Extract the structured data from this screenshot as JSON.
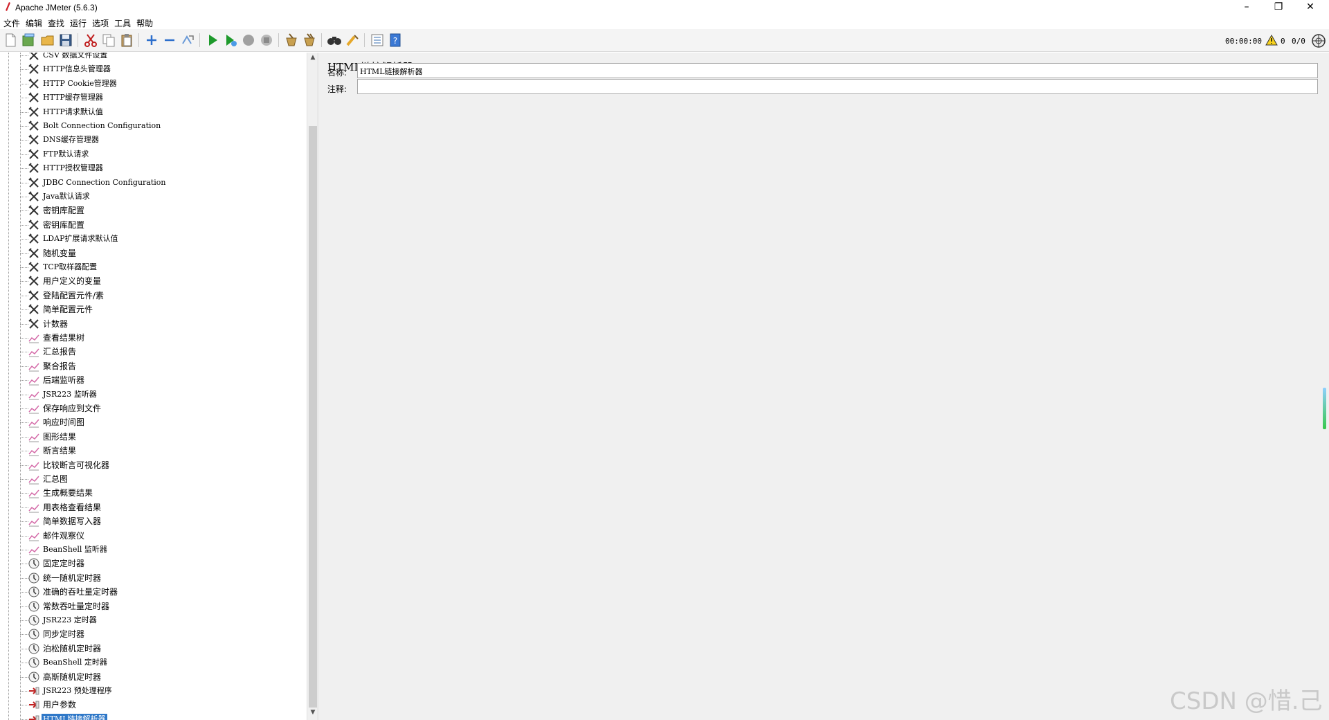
{
  "window": {
    "title": "Apache JMeter (5.6.3)",
    "minimize": "–",
    "restore": "❐",
    "close": "✕"
  },
  "menu": [
    "文件",
    "编辑",
    "查找",
    "运行",
    "选项",
    "工具",
    "帮助"
  ],
  "toolbar": {
    "buttons": [
      "new-icon",
      "templates-icon",
      "open-icon",
      "save-icon",
      "cut-icon",
      "copy-icon",
      "paste-icon",
      "expand-icon",
      "collapse-icon",
      "toggle-icon",
      "start-icon",
      "start-no-pause-icon",
      "stop-icon",
      "shutdown-icon",
      "clear-icon",
      "clear-all-icon",
      "search-icon",
      "reset-search-icon",
      "function-helper-icon",
      "help-icon"
    ]
  },
  "status": {
    "elapsed": "00:00:00",
    "warnings": "0",
    "threads": "0/0"
  },
  "tree": {
    "items": [
      {
        "label": "CSV 数据文件设置",
        "kind": "config"
      },
      {
        "label": "HTTP信息头管理器",
        "kind": "config"
      },
      {
        "label": "HTTP Cookie管理器",
        "kind": "config"
      },
      {
        "label": "HTTP缓存管理器",
        "kind": "config"
      },
      {
        "label": "HTTP请求默认值",
        "kind": "config"
      },
      {
        "label": "Bolt Connection Configuration",
        "kind": "config"
      },
      {
        "label": "DNS缓存管理器",
        "kind": "config"
      },
      {
        "label": "FTP默认请求",
        "kind": "config"
      },
      {
        "label": "HTTP授权管理器",
        "kind": "config"
      },
      {
        "label": "JDBC Connection Configuration",
        "kind": "config"
      },
      {
        "label": "Java默认请求",
        "kind": "config"
      },
      {
        "label": "密钥库配置",
        "kind": "config"
      },
      {
        "label": "密钥库配置",
        "kind": "config"
      },
      {
        "label": "LDAP扩展请求默认值",
        "kind": "config"
      },
      {
        "label": "随机变量",
        "kind": "config"
      },
      {
        "label": "TCP取样器配置",
        "kind": "config"
      },
      {
        "label": "用户定义的变量",
        "kind": "config"
      },
      {
        "label": "登陆配置元件/素",
        "kind": "config"
      },
      {
        "label": "简单配置元件",
        "kind": "config"
      },
      {
        "label": "计数器",
        "kind": "config"
      },
      {
        "label": "查看结果树",
        "kind": "listener"
      },
      {
        "label": "汇总报告",
        "kind": "listener"
      },
      {
        "label": "聚合报告",
        "kind": "listener"
      },
      {
        "label": "后端监听器",
        "kind": "listener"
      },
      {
        "label": "JSR223 监听器",
        "kind": "listener"
      },
      {
        "label": "保存响应到文件",
        "kind": "listener"
      },
      {
        "label": "响应时间图",
        "kind": "listener"
      },
      {
        "label": "图形结果",
        "kind": "listener"
      },
      {
        "label": "断言结果",
        "kind": "listener"
      },
      {
        "label": "比较断言可视化器",
        "kind": "listener"
      },
      {
        "label": "汇总图",
        "kind": "listener"
      },
      {
        "label": "生成概要结果",
        "kind": "listener"
      },
      {
        "label": "用表格查看结果",
        "kind": "listener"
      },
      {
        "label": "简单数据写入器",
        "kind": "listener"
      },
      {
        "label": "邮件观察仪",
        "kind": "listener"
      },
      {
        "label": "BeanShell 监听器",
        "kind": "listener"
      },
      {
        "label": "固定定时器",
        "kind": "timer"
      },
      {
        "label": "统一随机定时器",
        "kind": "timer"
      },
      {
        "label": "准确的吞吐量定时器",
        "kind": "timer"
      },
      {
        "label": "常数吞吐量定时器",
        "kind": "timer"
      },
      {
        "label": "JSR223 定时器",
        "kind": "timer"
      },
      {
        "label": "同步定时器",
        "kind": "timer"
      },
      {
        "label": "泊松随机定时器",
        "kind": "timer"
      },
      {
        "label": "BeanShell 定时器",
        "kind": "timer"
      },
      {
        "label": "高斯随机定时器",
        "kind": "timer"
      },
      {
        "label": "JSR223 预处理程序",
        "kind": "preprocessor"
      },
      {
        "label": "用户参数",
        "kind": "preprocessor"
      },
      {
        "label": "HTML链接解析器",
        "kind": "preprocessor",
        "selected": true
      }
    ]
  },
  "editor": {
    "title": "HTML链接解析器",
    "name_label": "名称:",
    "name_value": "HTML链接解析器",
    "comment_label": "注释:",
    "comment_value": ""
  },
  "watermark": "CSDN @惜.己"
}
